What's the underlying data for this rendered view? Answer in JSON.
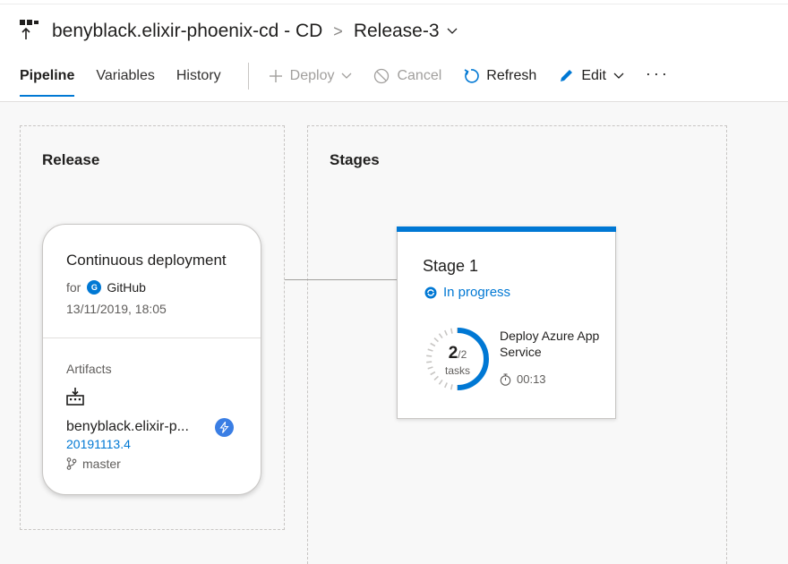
{
  "header": {
    "pipeline_name": "benyblack.elixir-phoenix-cd - CD",
    "separator": ">",
    "release_name": "Release-3",
    "pipeline_icon": "release-pipeline-icon"
  },
  "tabs": [
    {
      "label": "Pipeline",
      "active": true
    },
    {
      "label": "Variables",
      "active": false
    },
    {
      "label": "History",
      "active": false
    }
  ],
  "commands": {
    "deploy": "Deploy",
    "cancel": "Cancel",
    "refresh": "Refresh",
    "edit": "Edit",
    "more": "···"
  },
  "release_panel": {
    "title": "Release",
    "card": {
      "title": "Continuous deployment",
      "for_label": "for",
      "source_badge": "G",
      "source": "GitHub",
      "date": "13/11/2019, 18:05",
      "artifacts_label": "Artifacts",
      "artifact_name": "benyblack.elixir-p...",
      "artifact_version": "20191113.4",
      "artifact_branch": "master"
    }
  },
  "stages_panel": {
    "title": "Stages",
    "stage": {
      "name": "Stage 1",
      "status": "In progress",
      "tasks_done": "2",
      "tasks_total": "/2",
      "tasks_label": "tasks",
      "tasks_fraction": 1.0,
      "task_name": "Deploy Azure App Service",
      "elapsed": "00:13"
    }
  },
  "colors": {
    "accent": "#0078d4",
    "in_progress": "#0078d4",
    "trigger_badge": "#3a7ee4"
  }
}
